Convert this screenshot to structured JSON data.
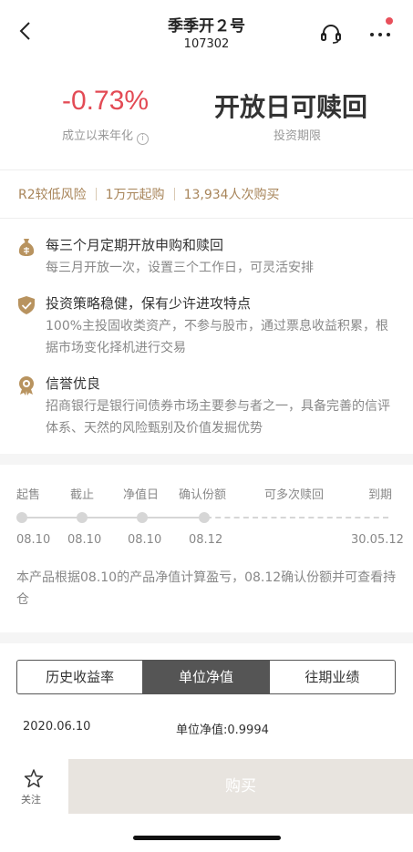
{
  "nav": {
    "title": "季季开２号",
    "subtitle": "107302"
  },
  "hero": {
    "rate": "-0.73%",
    "rate_label": "成立以来年化",
    "period": "开放日可赎回",
    "period_label": "投资期限"
  },
  "tags": [
    "R2较低风险",
    "1万元起购",
    "13,934人次购买"
  ],
  "features": [
    {
      "icon": "money-bag-icon",
      "title": "每三个月定期开放申购和赎回",
      "desc": "每三月开放一次，设置三个工作日，可灵活安排"
    },
    {
      "icon": "shield-check-icon",
      "title": "投资策略稳健，保有少许进攻特点",
      "desc": "100%主投固收类资产，不参与股市，通过票息收益积累，根据市场变化择机进行交易"
    },
    {
      "icon": "badge-icon",
      "title": "信誉优良",
      "desc": "招商银行是银行间债券市场主要参与者之一，具备完善的信评体系、天然的风险甄别及价值发掘优势"
    }
  ],
  "timeline": {
    "labels": [
      "起售",
      "截止",
      "净值日",
      "确认份额",
      "可多次赎回",
      "到期"
    ],
    "dates": [
      "08.10",
      "08.10",
      "08.10",
      "08.12",
      "30.05.12"
    ],
    "note": "本产品根据08.10的产品净值计算盈亏，08.12确认份额并可查看持仓"
  },
  "tabs": [
    "历史收益率",
    "单位净值",
    "往期业绩"
  ],
  "active_tab": "单位净值",
  "nav_row": {
    "date": "2020.06.10",
    "unit": "单位净值:0.9994"
  },
  "bottom": {
    "follow": "关注",
    "buy": "购买"
  },
  "colors": {
    "accent_red": "#e34b55",
    "tag_gold": "#a8855a",
    "icon_gold": "#b8935f",
    "buy_disabled": "#e8e4df"
  }
}
